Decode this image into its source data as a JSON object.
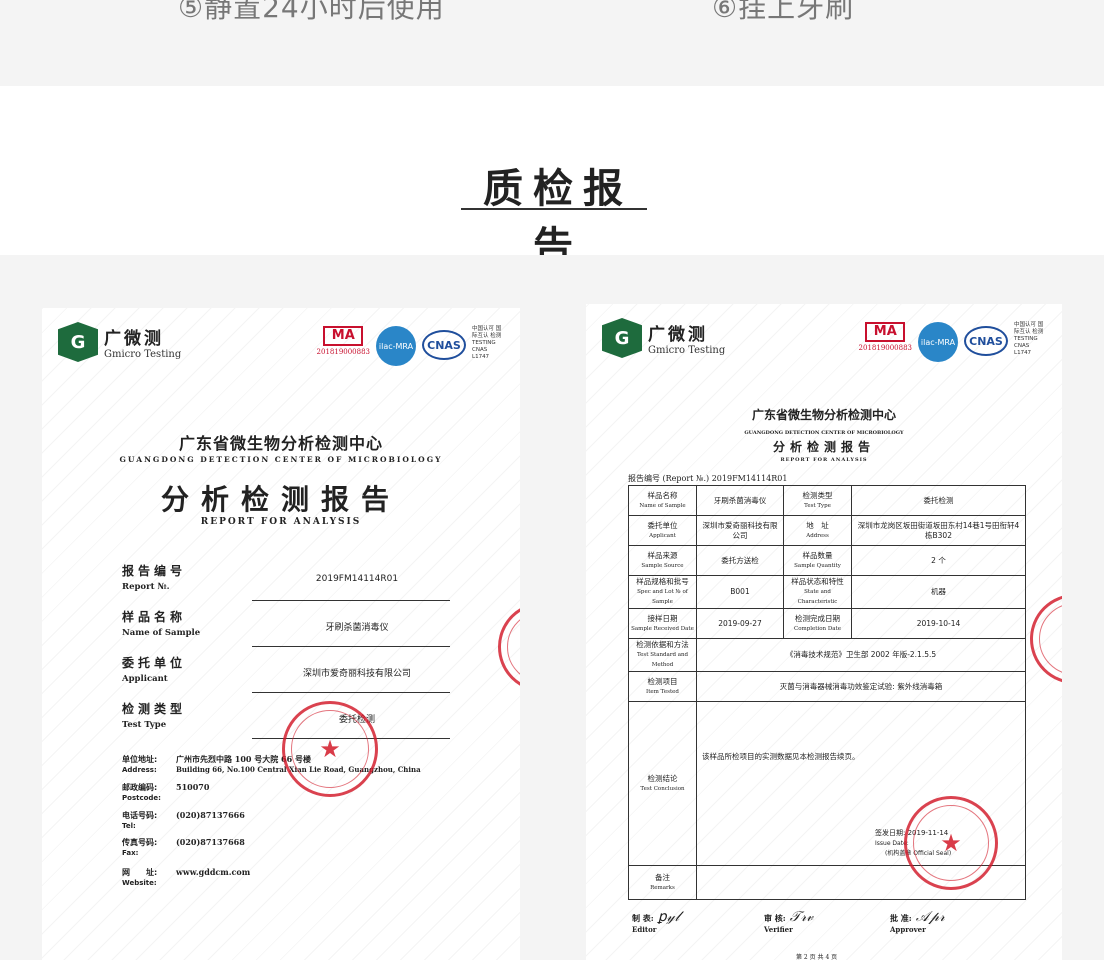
{
  "steps": {
    "step5": "⑤静置24小时后使用",
    "step6": "⑥挂上牙刷"
  },
  "section": {
    "title": "质检报告"
  },
  "left_cert": {
    "logo_cn": "广微测",
    "logo_en": "Gmicro Testing",
    "ma": "MA",
    "ma_number": "201819000883",
    "ilac": "ilac-MRA",
    "cnas": "CNAS",
    "cnas_note": "中国认可 国际互认 检测 TESTING CNAS L1747",
    "org_cn": "广东省微生物分析检测中心",
    "org_en": "GUANGDONG DETECTION CENTER OF MICROBIOLOGY",
    "report_cn": "分析检测报告",
    "report_en": "REPORT FOR ANALYSIS",
    "fields": [
      {
        "cn": "报告编号",
        "en": "Report №.",
        "value": "2019FM14114R01"
      },
      {
        "cn": "样品名称",
        "en": "Name of Sample",
        "value": "牙刷杀菌消毒仪"
      },
      {
        "cn": "委托单位",
        "en": "Applicant",
        "value": "深圳市爱奇丽科技有限公司"
      },
      {
        "cn": "检测类型",
        "en": "Test Type",
        "value": "委托检测"
      }
    ],
    "contacts": [
      {
        "k": "单位地址:",
        "ke": "Address:",
        "v": "广州市先烈中路 100 号大院 66 号楼",
        "ve": "Building 66, No.100 Central Xian Lie Road, Guangzhou, China"
      },
      {
        "k": "邮政编码:",
        "ke": "Postcode:",
        "v": "510070",
        "ve": ""
      },
      {
        "k": "电话号码:",
        "ke": "Tel:",
        "v": "(020)87137666",
        "ve": ""
      },
      {
        "k": "传真号码:",
        "ke": "Fax:",
        "v": "(020)87137668",
        "ve": ""
      },
      {
        "k": "网　　址:",
        "ke": "Website:",
        "v": "www.gddcm.com",
        "ve": ""
      }
    ]
  },
  "right_cert": {
    "logo_cn": "广微测",
    "logo_en": "Gmicro Testing",
    "ma": "MA",
    "ma_number": "201819000883",
    "ilac": "ilac-MRA",
    "cnas": "CNAS",
    "cnas_note": "中国认可 国际互认 检测 TESTING CNAS L1747",
    "org_cn": "广东省微生物分析检测中心",
    "org_en": "GUANGDONG DETECTION CENTER OF MICROBIOLOGY",
    "report_cn": "分析检测报告",
    "report_en": "REPORT FOR ANALYSIS",
    "report_no": "报告编号 (Report №.) 2019FM14114R01",
    "rows": {
      "sample_name_cn": "样品名称",
      "sample_name_en": "Name of Sample",
      "sample_name": "牙刷杀菌消毒仪",
      "test_type_cn": "检测类型",
      "test_type_en": "Test Type",
      "test_type": "委托检测",
      "applicant_cn": "委托单位",
      "applicant_en": "Applicant",
      "applicant": "深圳市爱奇丽科技有限公司",
      "address_cn": "地　址",
      "address_en": "Address",
      "address": "深圳市龙岗区坂田街道坂田东村14巷1号田衔轩4栋B302",
      "source_cn": "样品来源",
      "source_en": "Sample Source",
      "source": "委托方送检",
      "quantity_cn": "样品数量",
      "quantity_en": "Sample Quantity",
      "quantity": "2 个",
      "spec_cn": "样品规格和批号",
      "spec_en": "Spec and Lot № of Sample",
      "spec": "B001",
      "state_cn": "样品状态和特性",
      "state_en": "State and Characteristic",
      "state": "机器",
      "received_cn": "接样日期",
      "received_en": "Sample Received Date",
      "received": "2019-09-27",
      "completed_cn": "检测完成日期",
      "completed_en": "Completion Date",
      "completed": "2019-10-14",
      "standard_cn": "检测依据和方法",
      "standard_en": "Test Standard and Method",
      "standard": "《消毒技术规范》卫生部 2002 年版-2.1.5.5",
      "item_cn": "检测项目",
      "item_en": "Item Tested",
      "item": "灭菌与消毒器械消毒功效鉴定试验: 紫外线消毒箱",
      "conclusion_cn": "检测结论",
      "conclusion_en": "Test Conclusion",
      "conclusion": "该样品所检项目的实测数据见本检测报告续页。",
      "issue_date": "签发日期: 2019-11-14",
      "issue_date_en": "Issue Date:",
      "official_seal": "(机构盖章 Official Seal)",
      "remarks_cn": "备注",
      "remarks_en": "Remarks"
    },
    "editor_cn": "制 表:",
    "editor_en": "Editor",
    "verifier_cn": "审 核:",
    "verifier_en": "Verifier",
    "approver_cn": "批 准:",
    "approver_en": "Approver",
    "page": "第 2 页 共 4 页"
  }
}
